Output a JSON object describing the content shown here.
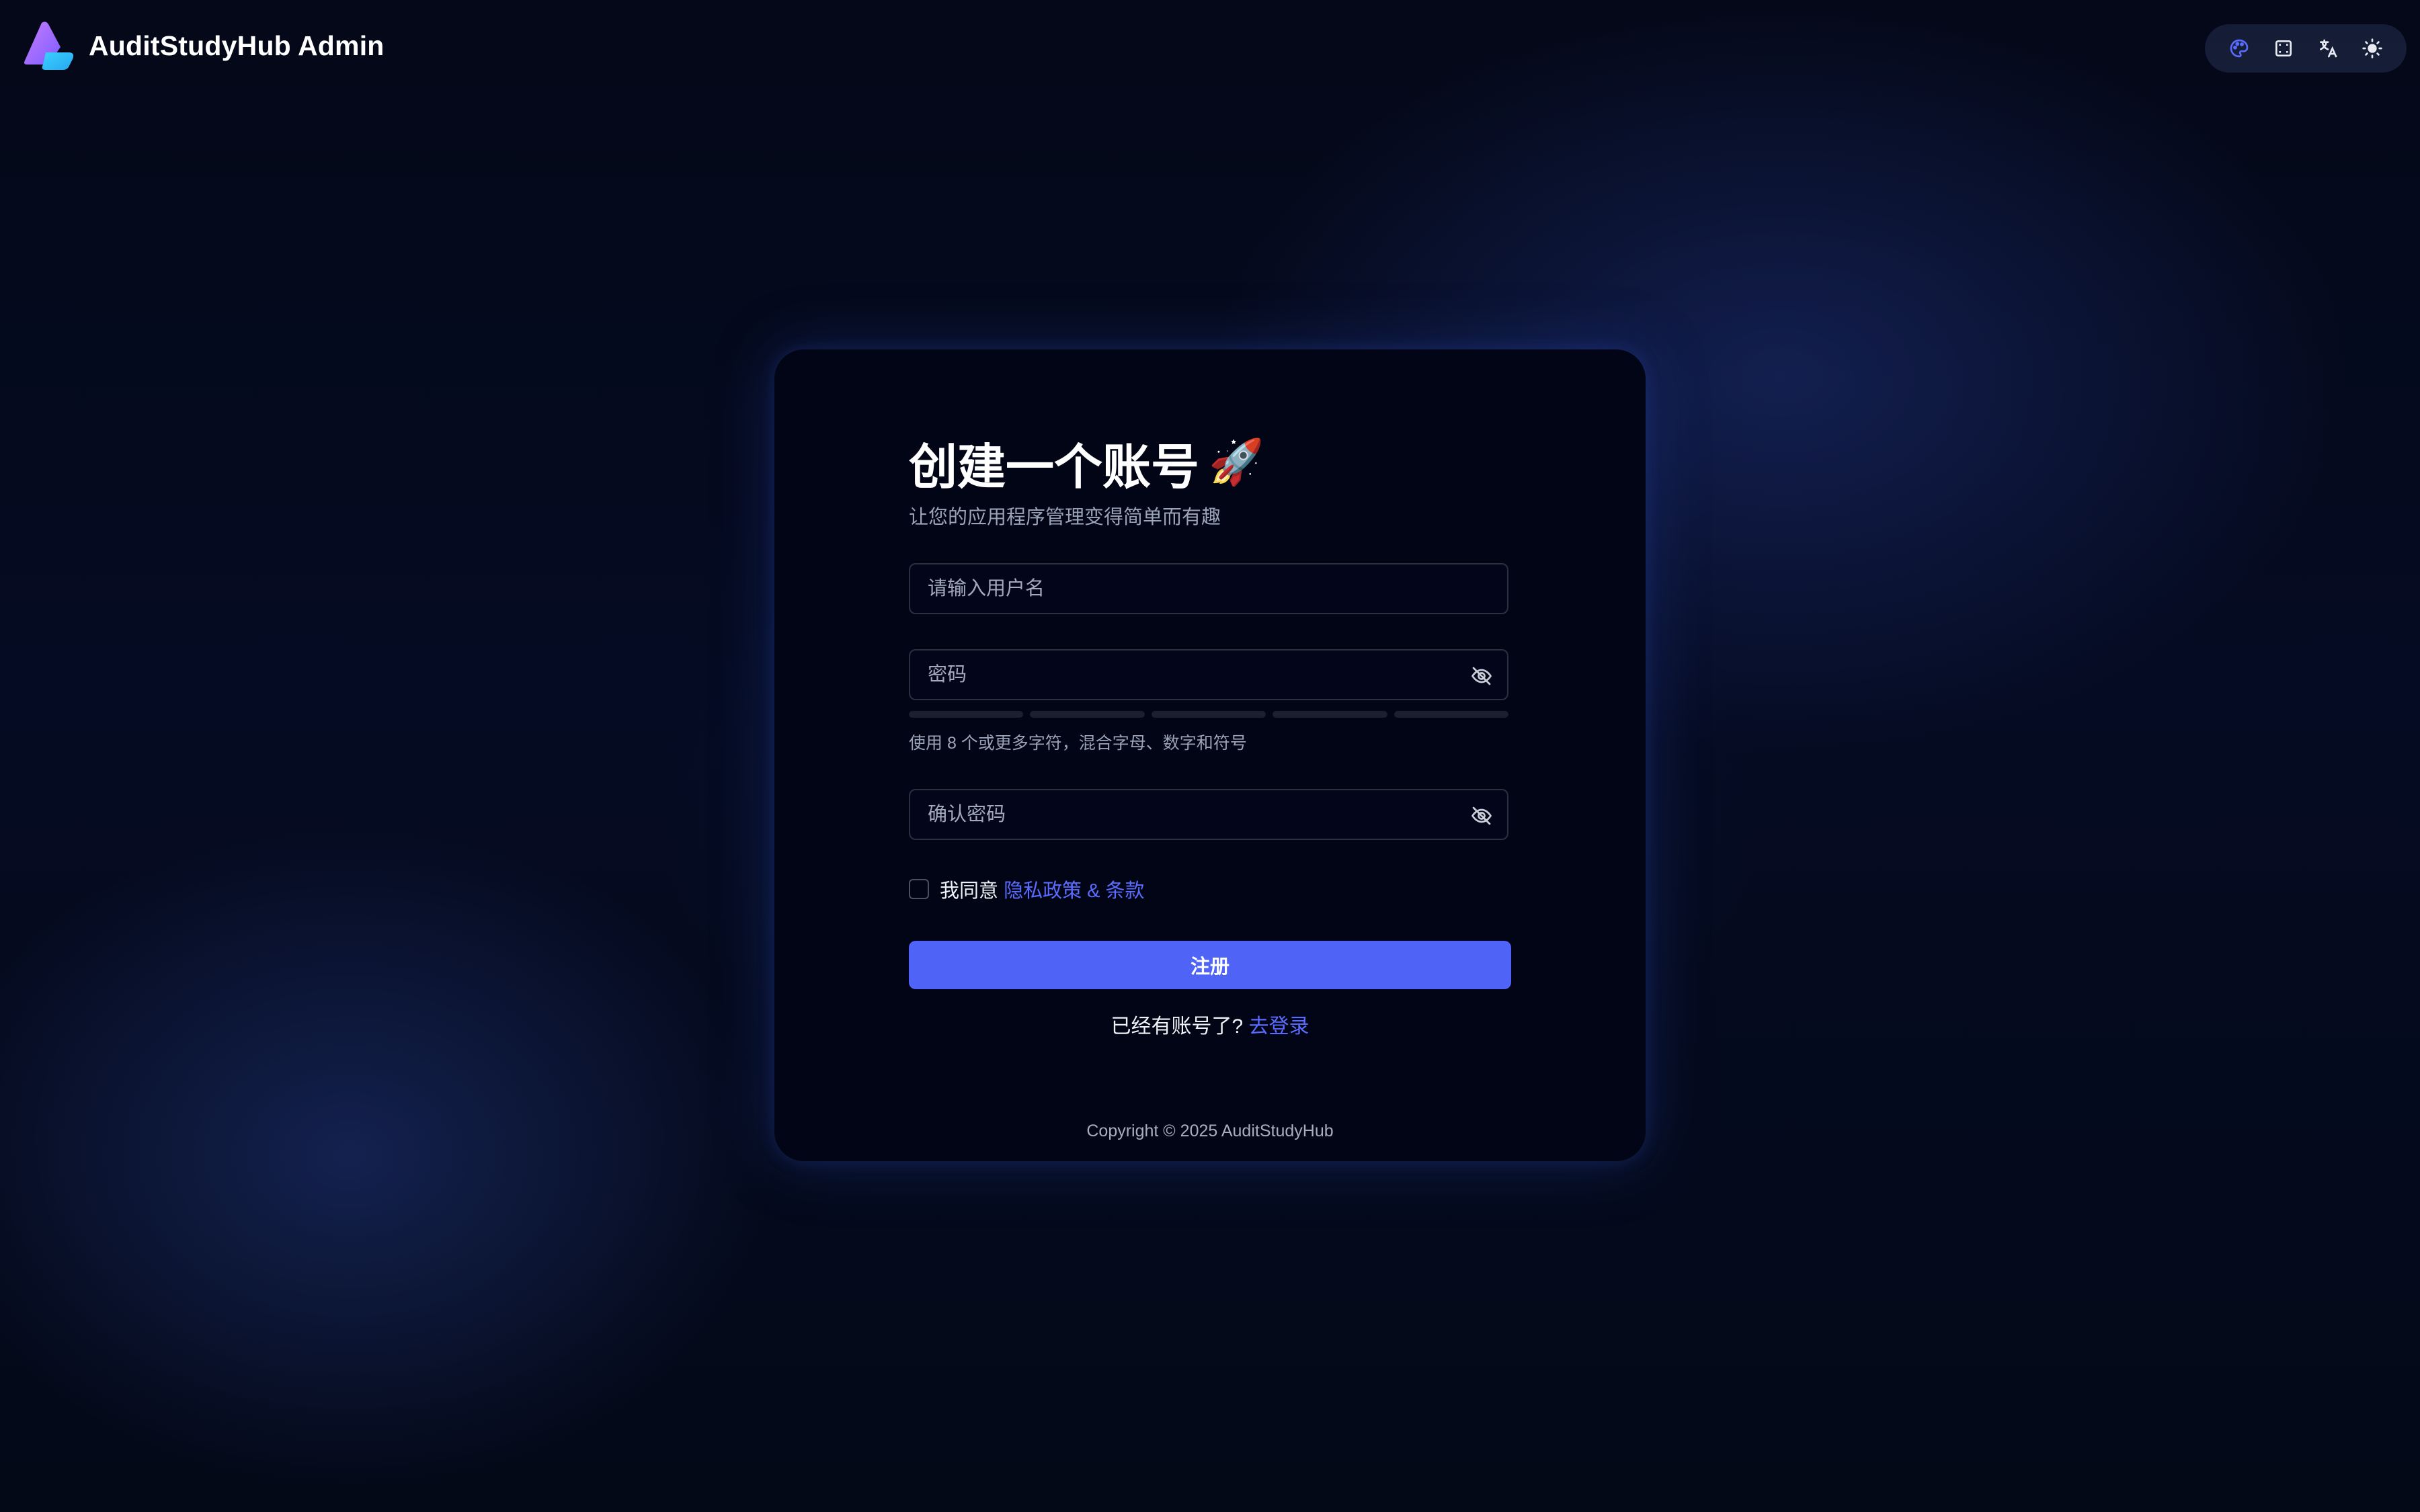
{
  "app": {
    "title": "AuditStudyHub Admin"
  },
  "toolbar": {
    "icons": [
      "palette-icon",
      "fullscreen-icon",
      "translate-icon",
      "sun-icon"
    ],
    "accent": "#4f63f7"
  },
  "register": {
    "title": "创建一个账号",
    "title_emoji": "🚀",
    "subtitle": "让您的应用程序管理变得简单而有趣",
    "username_placeholder": "请输入用户名",
    "password_placeholder": "密码",
    "password_hint": "使用 8 个或更多字符，混合字母、数字和符号",
    "password_strength_segments": 5,
    "password_strength_level": 0,
    "confirm_placeholder": "确认密码",
    "agree_text": "我同意",
    "agree_link": "隐私政策 & 条款",
    "agree_checked": false,
    "submit_label": "注册",
    "has_account_text": "已经有账号了?",
    "login_link": "去登录"
  },
  "footer": {
    "copyright": "Copyright © 2025 AuditStudyHub"
  },
  "colors": {
    "background": "#050b22",
    "card": "#020515",
    "primary": "#4f63f7",
    "link": "#5a6cff"
  }
}
